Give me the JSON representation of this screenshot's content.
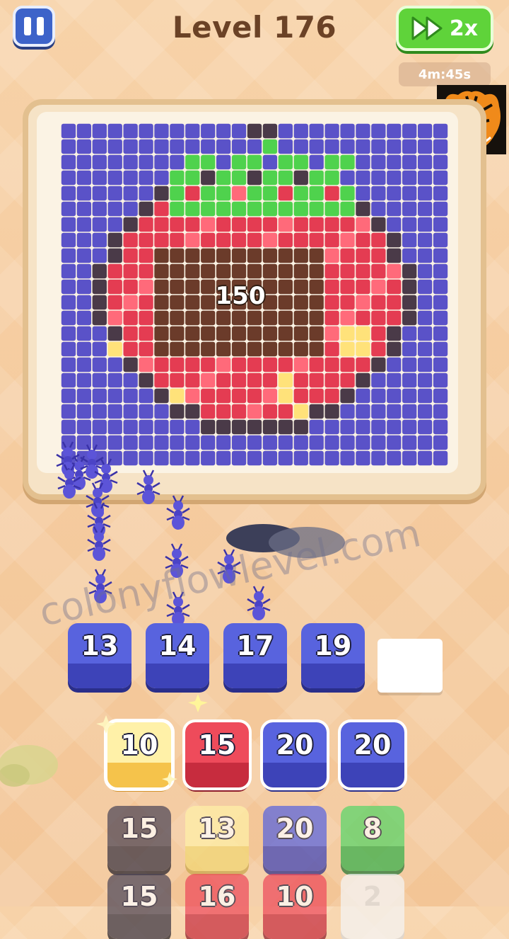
{
  "header": {
    "level_title": "Level 176",
    "speed_label": "2x",
    "timer": "4m:45s"
  },
  "board": {
    "remaining_count": "150",
    "picture": "strawberry pixel art",
    "colors": {
      "background": "#5a52c8",
      "outline": "#4a3a48",
      "red": "#e43c52",
      "red_light": "#ff6a7a",
      "brown": "#6b3b2a",
      "green": "#4fd24d",
      "yellow": "#ffe27a"
    }
  },
  "conveyor_tiles": [
    {
      "value": "13",
      "color": "blue"
    },
    {
      "value": "14",
      "color": "blue"
    },
    {
      "value": "17",
      "color": "blue"
    },
    {
      "value": "19",
      "color": "blue"
    }
  ],
  "tray": {
    "row1": [
      {
        "value": "10",
        "color": "yellow"
      },
      {
        "value": "15",
        "color": "red"
      },
      {
        "value": "20",
        "color": "blue"
      },
      {
        "value": "20",
        "color": "blue"
      }
    ],
    "row2": [
      {
        "value": "15",
        "color": "dark"
      },
      {
        "value": "13",
        "color": "paleyellow"
      },
      {
        "value": "20",
        "color": "blue"
      },
      {
        "value": "8",
        "color": "green"
      }
    ],
    "row3": [
      {
        "value": "15",
        "color": "dark"
      },
      {
        "value": "16",
        "color": "red"
      },
      {
        "value": "10",
        "color": "red"
      },
      {
        "value": "2",
        "color": "white"
      }
    ]
  },
  "watermark": "colonyflowlevel.com"
}
